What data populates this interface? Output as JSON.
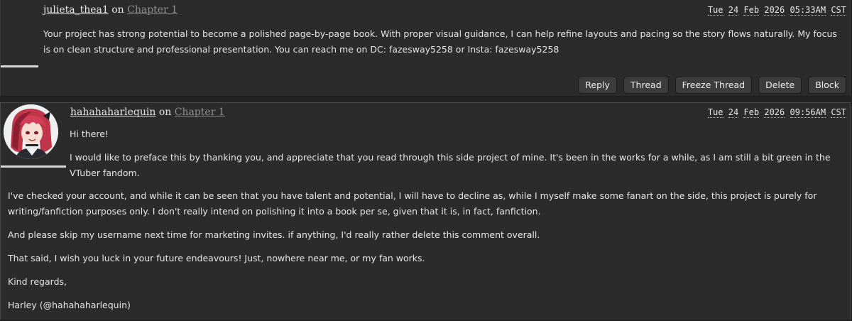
{
  "comments": [
    {
      "username": "julieta_thea1",
      "on": "on",
      "chapter": "Chapter 1",
      "datetime": {
        "day": "Tue",
        "date": "24",
        "month": "Feb",
        "year": "2026",
        "time": "05:33AM",
        "tz": "CST"
      },
      "paragraphs": [
        "Your project has strong potential to become a polished page-by-page book. With proper visual guidance, I can help refine layouts and pacing so the story flows naturally. My focus is on clean structure and professional presentation. You can reach me on DC: fazesway5258 or Insta: fazesway5258"
      ],
      "actions": [
        "Reply",
        "Thread",
        "Freeze Thread",
        "Delete",
        "Block"
      ]
    },
    {
      "username": "hahahaharlequin",
      "on": "on",
      "chapter": "Chapter 1",
      "datetime": {
        "day": "Tue",
        "date": "24",
        "month": "Feb",
        "year": "2026",
        "time": "09:56AM",
        "tz": "CST"
      },
      "paragraphs": [
        "Hi there!",
        "I would like to preface this by thanking you, and appreciate that you read through this side project of mine. It's been in the works for a while, as I am still a bit green in the VTuber fandom.",
        "I've checked your account, and while it can be seen that you have talent and potential, I will have to decline as, while I myself make some fanart on the side, this project is purely for writing/fanfiction purposes only. I don't really intend on polishing it into a book per se, given that it is, in fact, fanfiction.",
        "And please skip my username next time for marketing invites. if anything, I'd really rather delete this comment overall.",
        "That said, I wish you luck in your future endeavours! Just, nowhere near me, or my fan works.",
        "Kind regards,",
        "Harley (@hahahaharlequin)"
      ]
    }
  ],
  "icons": {
    "avatar": "user-avatar-illustration"
  }
}
